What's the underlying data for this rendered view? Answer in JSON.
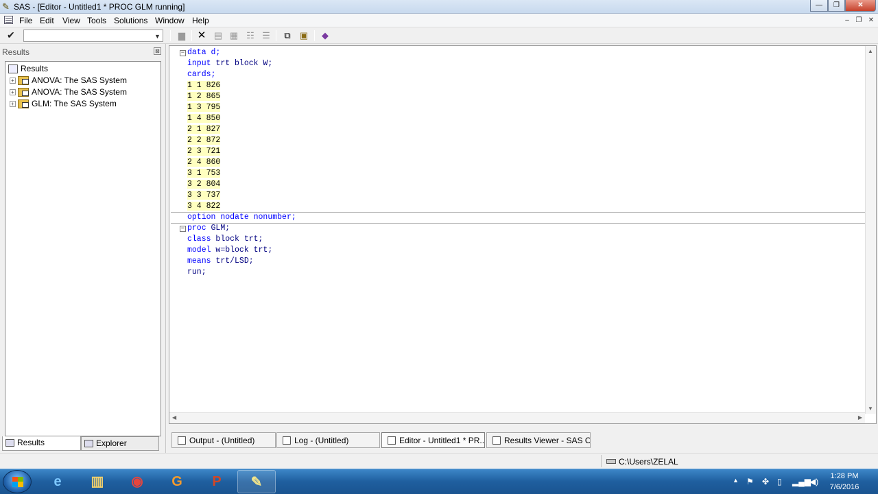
{
  "window": {
    "title": "SAS - [Editor - Untitled1 *   PROC GLM running]",
    "minimize": "—",
    "maximize": "❐",
    "close": "✕"
  },
  "menu": [
    "File",
    "Edit",
    "View",
    "Tools",
    "Solutions",
    "Window",
    "Help"
  ],
  "mdi_buttons": [
    "–",
    "❐",
    "✕"
  ],
  "command_box": {
    "value": ""
  },
  "results_panel": {
    "header": "Results",
    "close": "⊠",
    "root": "Results",
    "items": [
      "ANOVA:  The SAS System",
      "ANOVA:  The SAS System",
      "GLM:  The SAS System"
    ],
    "expand_glyph": "+"
  },
  "left_tabs": [
    "Results",
    "Explorer"
  ],
  "editor": {
    "fold_glyph": "−",
    "line1": "data d;",
    "line2_kw": "input",
    "line2_rest": " trt block W;",
    "line3": "cards;",
    "cards": [
      "1 1 826",
      "1 2 865",
      "1 3 795",
      "1 4 850",
      "2 1 827",
      "2 2 872",
      "2 3 721",
      "2 4 860",
      "3 1 753",
      "3 2 804",
      "3 3 737",
      "3 4 822"
    ],
    "option_kw": "option",
    "option_rest": " nodate nonumber;",
    "proc_kw": "proc",
    "proc_rest": " GLM;",
    "class_kw": "class",
    "class_rest": " block trt;",
    "model_kw": "model",
    "model_rest": " w=block trt;",
    "means_kw": "means",
    "means_rest": " trt/LSD;",
    "run": "run;"
  },
  "window_tabs": [
    "Output - (Untitled)",
    "Log - (Untitled)",
    "Editor - Untitled1 *   PR...",
    "Results Viewer - SAS Ou..."
  ],
  "status": {
    "path": "C:\\Users\\ZELAL"
  },
  "taskbar": {
    "time": "1:28 PM",
    "date": "7/6/2016"
  },
  "colors": {
    "keyword": "#0000ff",
    "code": "#000080",
    "datalines_bg": "#ffffc0"
  }
}
